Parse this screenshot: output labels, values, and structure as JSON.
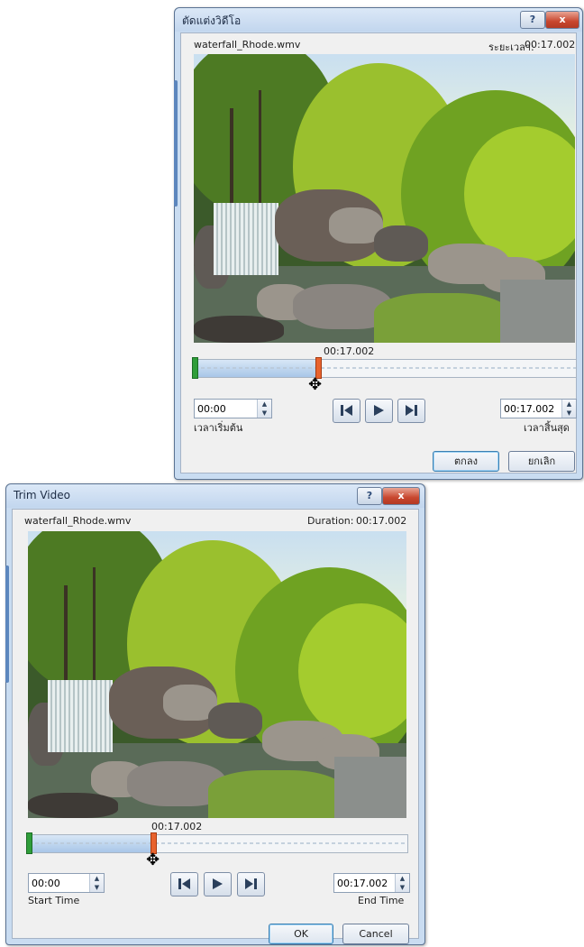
{
  "thai_dialog": {
    "title": "ตัดแต่งวิดีโอ",
    "filename": "waterfall_Rhode.wmv",
    "duration_label": "ระยะเวลา:",
    "duration_value": "00:17.002",
    "position_time": "00:17.002",
    "start_time": {
      "value": "00:00",
      "label": "เวลาเริ่มต้น"
    },
    "end_time": {
      "value": "00:17.002",
      "label": "เวลาสิ้นสุด"
    },
    "ok_label": "ตกลง",
    "cancel_label": "ยกเลิก",
    "help_label": "?",
    "close_label": "x"
  },
  "english_dialog": {
    "title": "Trim Video",
    "filename": "waterfall_Rhode.wmv",
    "duration_label": "Duration:",
    "duration_value": "00:17.002",
    "position_time": "00:17.002",
    "start_time": {
      "value": "00:00",
      "label": "Start Time"
    },
    "end_time": {
      "value": "00:17.002",
      "label": "End Time"
    },
    "ok_label": "OK",
    "cancel_label": "Cancel",
    "help_label": "?",
    "close_label": "x"
  },
  "icons": [
    "help-icon",
    "close-icon",
    "previous-frame-icon",
    "play-icon",
    "next-frame-icon",
    "move-cursor-icon",
    "spin-arrows-icon"
  ],
  "colors": {
    "accent": "#3c7fb1",
    "close": "#c8462e",
    "start_marker": "#2f9d3a",
    "end_marker": "#e8632e"
  }
}
